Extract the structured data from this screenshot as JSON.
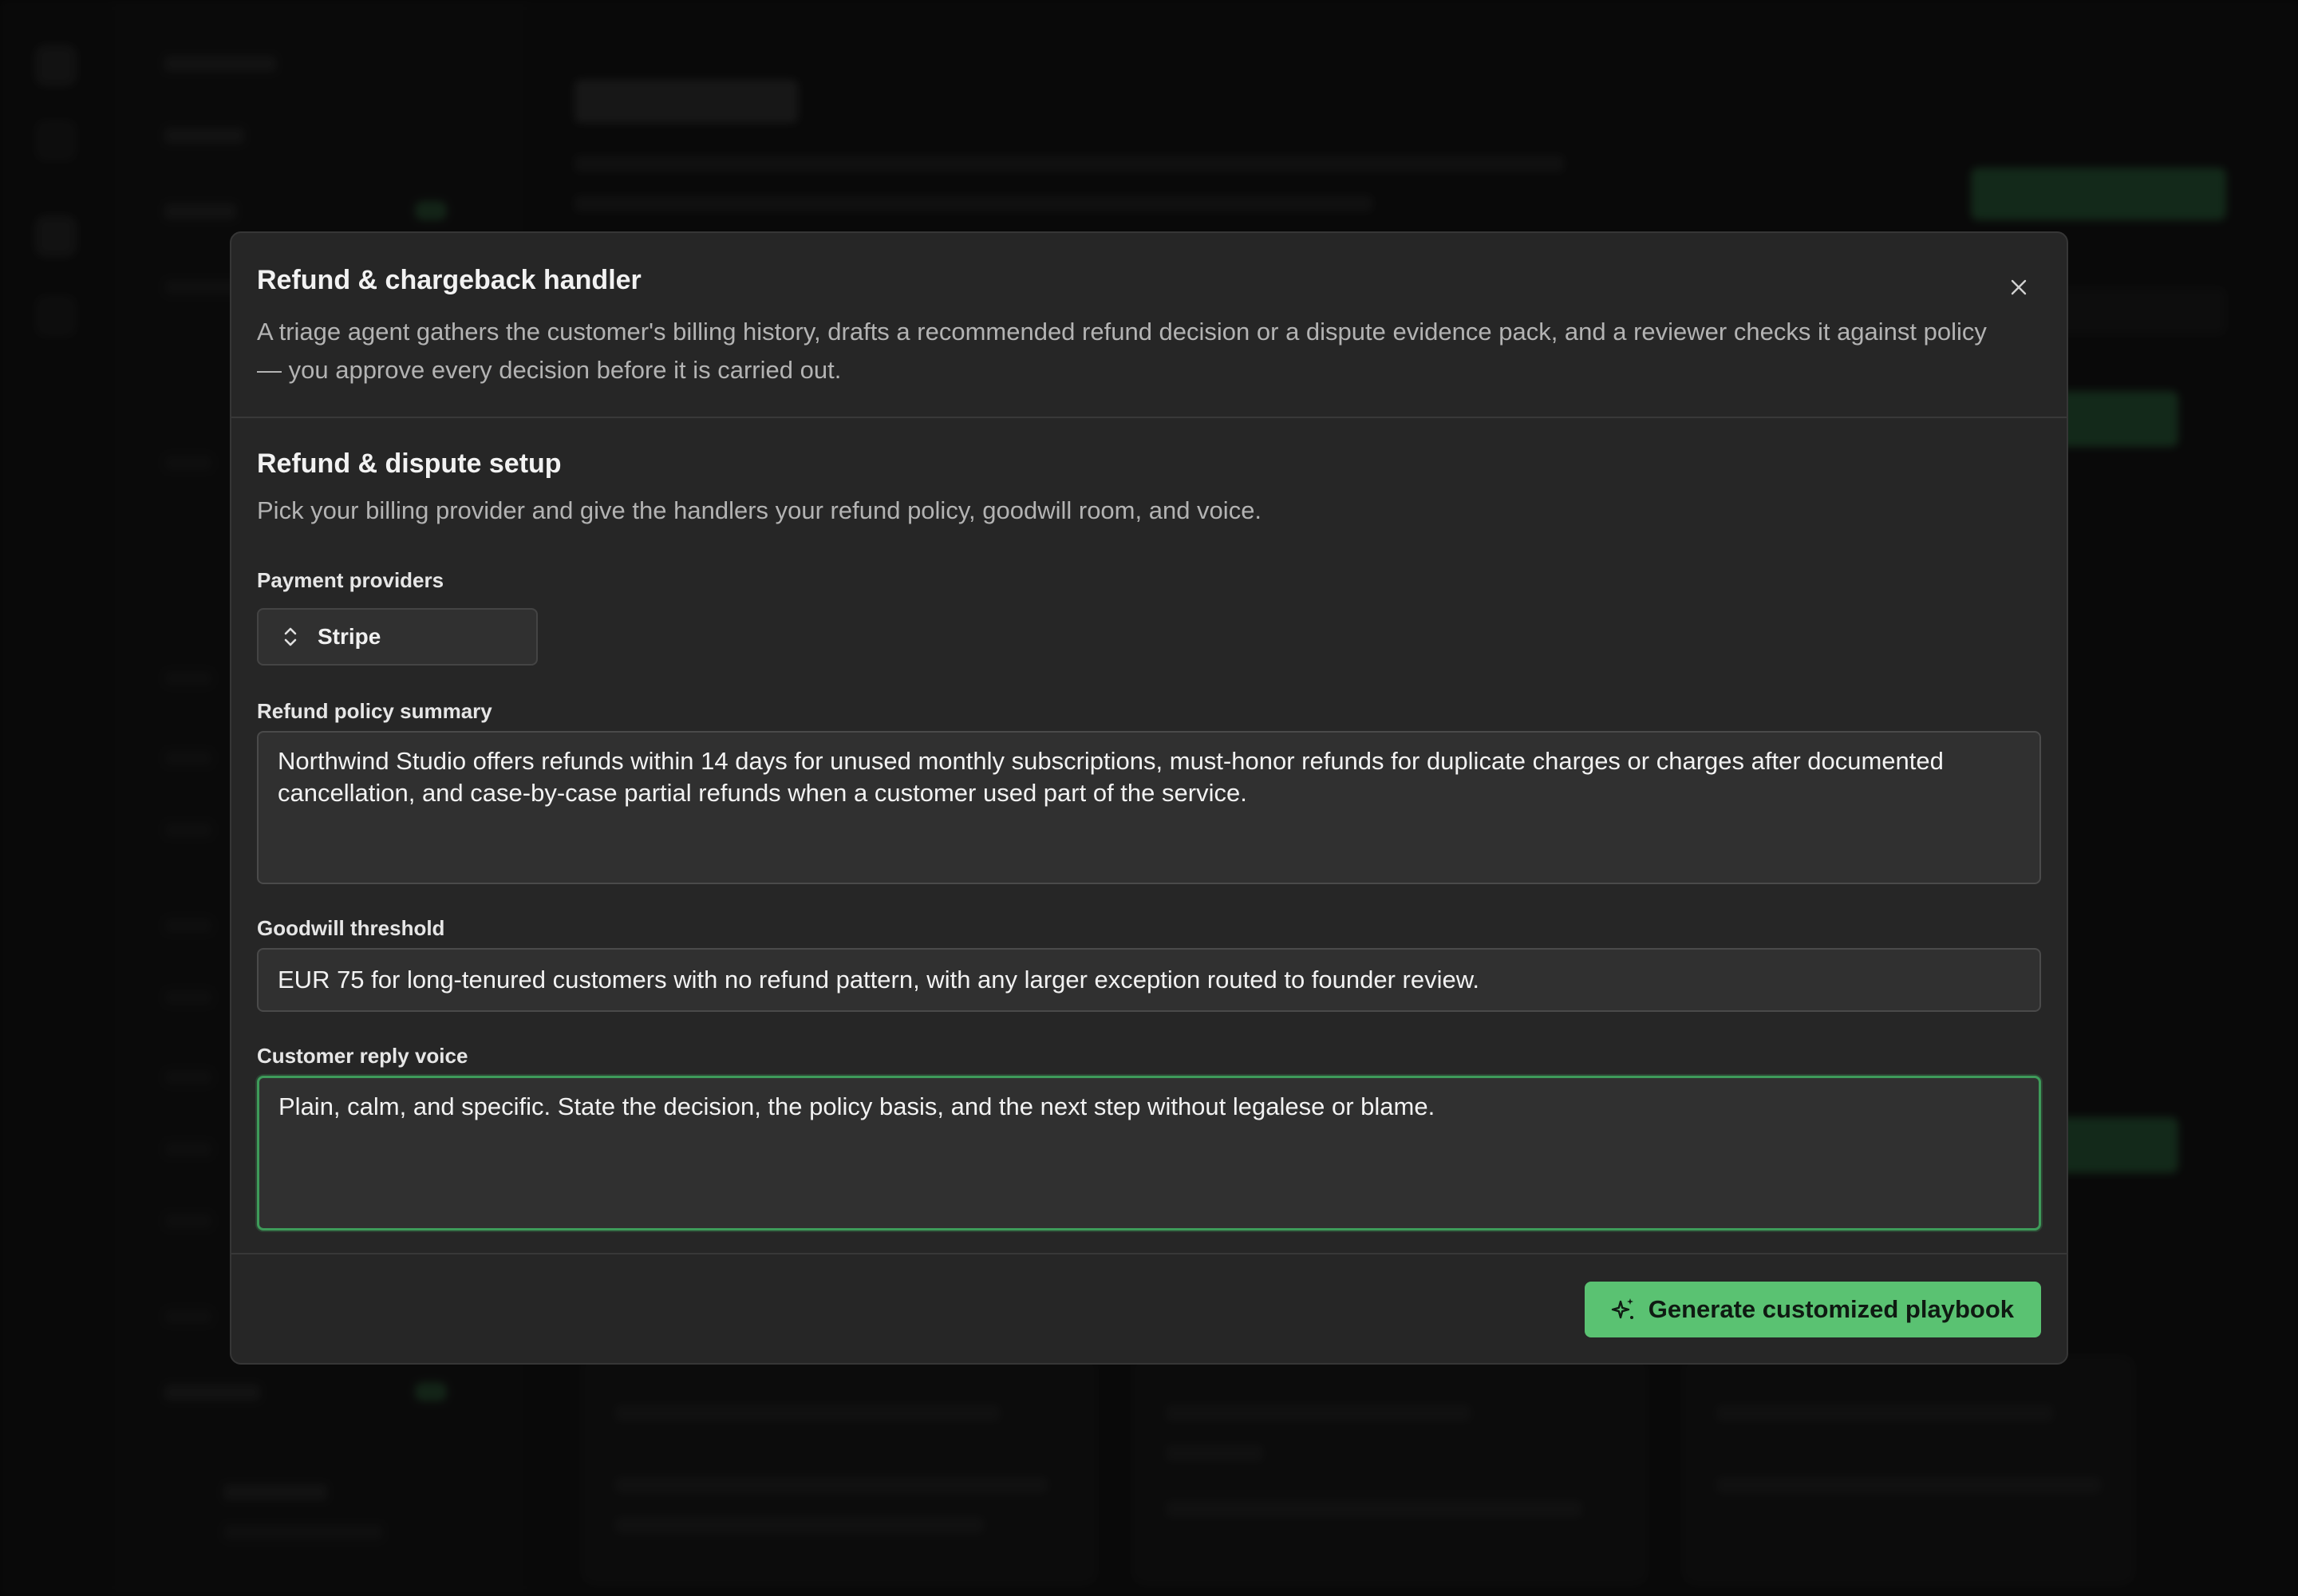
{
  "modal": {
    "title": "Refund & chargeback handler",
    "description": "A triage agent gathers the customer's billing history, drafts a recommended refund decision or a dispute evidence pack, and a reviewer checks it against policy — you approve every decision before it is carried out.",
    "close_icon": "close-icon"
  },
  "setup": {
    "title": "Refund & dispute setup",
    "description": "Pick your billing provider and give the handlers your refund policy, goodwill room, and voice."
  },
  "payment_providers": {
    "label": "Payment providers",
    "value": "Stripe",
    "icon": "chevron-up-down-icon"
  },
  "refund_policy": {
    "label": "Refund policy summary",
    "value": "Northwind Studio offers refunds within 14 days for unused monthly subscriptions, must-honor refunds for duplicate charges or charges after documented cancellation, and case-by-case partial refunds when a customer used part of the service."
  },
  "goodwill": {
    "label": "Goodwill threshold",
    "value": "EUR 75 for long-tenured customers with no refund pattern, with any larger exception routed to founder review."
  },
  "reply_voice": {
    "label": "Customer reply voice",
    "value": "Plain, calm, and specific. State the decision, the policy basis, and the next step without legalese or blame."
  },
  "footer": {
    "generate_label": "Generate customized playbook",
    "generate_icon": "sparkle-icon"
  },
  "colors": {
    "accent": "#5ac272",
    "focus_border": "#3e9b5a",
    "modal_bg": "#262626",
    "field_bg": "#303030"
  }
}
